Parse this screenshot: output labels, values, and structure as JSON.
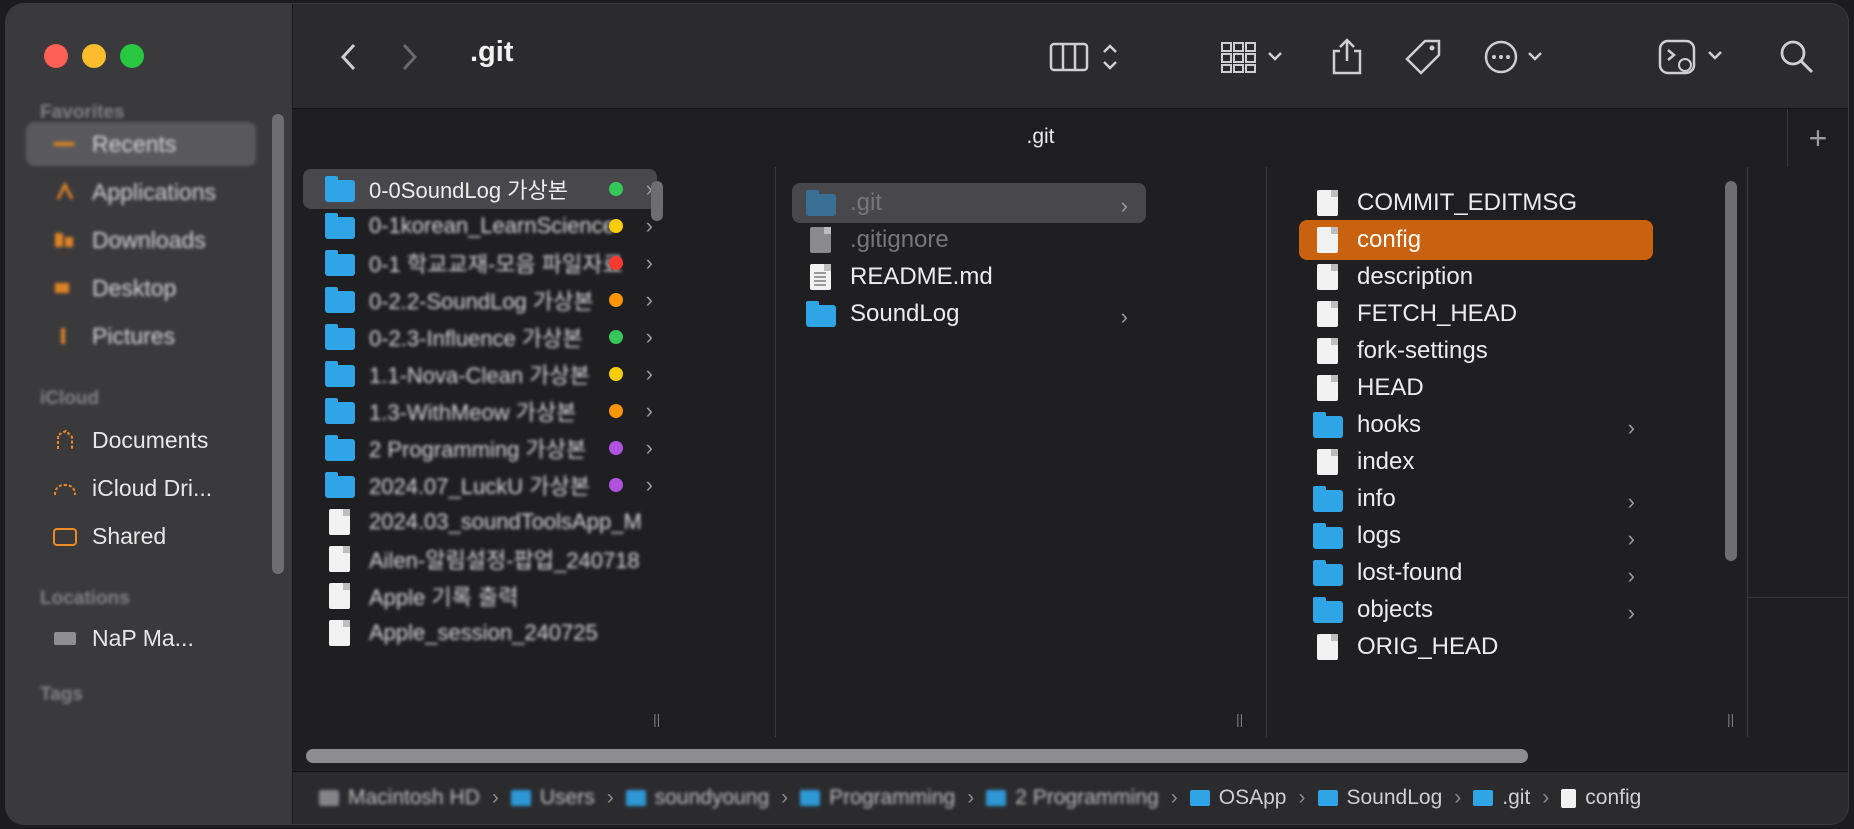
{
  "sidebar": {
    "sections": {
      "favorites": "Favorites",
      "icloud": "iCloud",
      "locations": "Locations",
      "tags": "Tags"
    },
    "favorites": [
      "Recents",
      "Applications",
      "Downloads",
      "Desktop",
      "Pictures"
    ],
    "icloud": [
      "Documents",
      "iCloud Dri...",
      "Shared"
    ],
    "locations": [
      "NaP Ma..."
    ]
  },
  "toolbar": {
    "title": ".git"
  },
  "tabbar": {
    "title": ".git",
    "plus": "+"
  },
  "column1": [
    {
      "name": "0-0SoundLog 가상본",
      "tag": "#35c759",
      "selected": true
    },
    {
      "name": "0-1korean_LearnScience",
      "tag": "#ffcc00"
    },
    {
      "name": "0-1 학교교재-모음 파일자료",
      "tag": "#ff3b30"
    },
    {
      "name": "0-2.2-SoundLog 가상본",
      "tag": "#ff9500"
    },
    {
      "name": "0-2.3-Influence 가상본",
      "tag": "#35c759"
    },
    {
      "name": "1.1-Nova-Clean 가상본",
      "tag": "#ffcc00"
    },
    {
      "name": "1.3-WithMeow 가상본",
      "tag": "#ff9500"
    },
    {
      "name": "2 Programming 가상본",
      "tag": "#af52de"
    },
    {
      "name": "2024.07_LuckU 가상본",
      "tag": "#af52de"
    },
    {
      "name": "2024.03_soundToolsApp_M"
    },
    {
      "name": "Ailen-알림설정-팝업_240718"
    },
    {
      "name": "Apple 기록 출력"
    },
    {
      "name": "Apple_session_240725"
    }
  ],
  "column2": [
    {
      "name": ".git",
      "type": "folder",
      "selected": true,
      "dim": true,
      "chevron": "›"
    },
    {
      "name": ".gitignore",
      "type": "file",
      "dim": true
    },
    {
      "name": "README.md",
      "type": "doc"
    },
    {
      "name": "SoundLog",
      "type": "folder",
      "chevron": "›"
    }
  ],
  "column3": [
    {
      "name": "COMMIT_EDITMSG",
      "type": "file"
    },
    {
      "name": "config",
      "type": "file",
      "selected": true
    },
    {
      "name": "description",
      "type": "file"
    },
    {
      "name": "FETCH_HEAD",
      "type": "file"
    },
    {
      "name": "fork-settings",
      "type": "file"
    },
    {
      "name": "HEAD",
      "type": "file"
    },
    {
      "name": "hooks",
      "type": "folder",
      "chevron": "›"
    },
    {
      "name": "index",
      "type": "file"
    },
    {
      "name": "info",
      "type": "folder",
      "chevron": "›"
    },
    {
      "name": "logs",
      "type": "folder",
      "chevron": "›"
    },
    {
      "name": "lost-found",
      "type": "folder",
      "chevron": "›"
    },
    {
      "name": "objects",
      "type": "folder",
      "chevron": "›"
    },
    {
      "name": "ORIG_HEAD",
      "type": "file"
    }
  ],
  "pathbar": [
    {
      "name": "Macintosh HD",
      "kind": "disk",
      "blur": true
    },
    {
      "name": "Users",
      "kind": "folder",
      "blur": true
    },
    {
      "name": "soundyoung",
      "kind": "folder",
      "blur": true
    },
    {
      "name": "Programming",
      "kind": "folder",
      "blur": true
    },
    {
      "name": "2 Programming",
      "kind": "folder",
      "blur": true
    },
    {
      "name": "OSApp",
      "kind": "folder"
    },
    {
      "name": "SoundLog",
      "kind": "folder"
    },
    {
      "name": ".git",
      "kind": "folder"
    },
    {
      "name": "config",
      "kind": "file"
    }
  ],
  "colors": {
    "accent_orange": "#c8620e",
    "folder_blue": "#2fa4e7"
  }
}
